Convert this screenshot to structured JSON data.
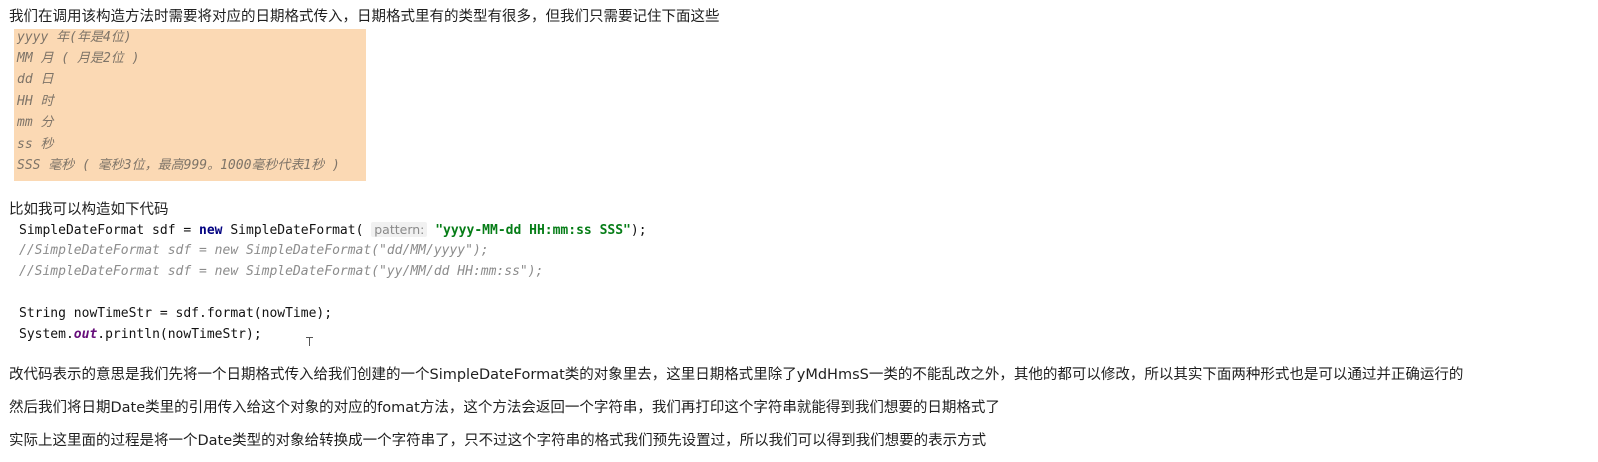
{
  "intro_text": "我们在调用该构造方法时需要将对应的日期格式传入，日期格式里有的类型有很多，但我们只需要记住下面这些",
  "format_table": [
    "yyyy 年(年是4位)",
    "MM 月 ( 月是2位 )",
    "dd 日",
    "HH 时",
    "mm 分",
    "ss 秒",
    "SSS 毫秒 ( 毫秒3位，最高999。1000毫秒代表1秒 )"
  ],
  "example_text": "比如我可以构造如下代码",
  "code": {
    "line1": {
      "type": "SimpleDateFormat",
      "var": " sdf = ",
      "keyword": "new",
      "ctor": " SimpleDateFormat(",
      "hint": "pattern:",
      "string": "\"yyyy-MM-dd HH:mm:ss SSS\"",
      "end": ");"
    },
    "comment1": "//SimpleDateFormat sdf = new SimpleDateFormat(\"dd/MM/yyyy\");",
    "comment2": "//SimpleDateFormat sdf = new SimpleDateFormat(\"yy/MM/dd HH:mm:ss\");",
    "line4": "String nowTimeStr = sdf.format(nowTime);",
    "line5": {
      "prefix": "System.",
      "field": "out",
      "suffix": ".println(nowTimeStr);"
    }
  },
  "explain": [
    "改代码表示的意思是我们先将一个日期格式传入给我们创建的一个SimpleDateFormat类的对象里去，这里日期格式里除了yMdHmsS一类的不能乱改之外，其他的都可以修改，所以其实下面两种形式也是可以通过并正确运行的",
    "然后我们将日期Date类里的引用传入给这个对象的对应的fomat方法，这个方法会返回一个字符串，我们再打印这个字符串就能得到我们想要的日期格式了",
    "实际上这里面的过程是将一个Date类型的对象给转换成一个字符串了，只不过这个字符串的格式我们预先设置过，所以我们可以得到我们想要的表示方式"
  ],
  "colors": {
    "format_box_bg": "#fbd9b4",
    "keyword": "#000080",
    "string": "#067d17",
    "comment": "#8c8c8c",
    "static_field": "#660e7a"
  }
}
